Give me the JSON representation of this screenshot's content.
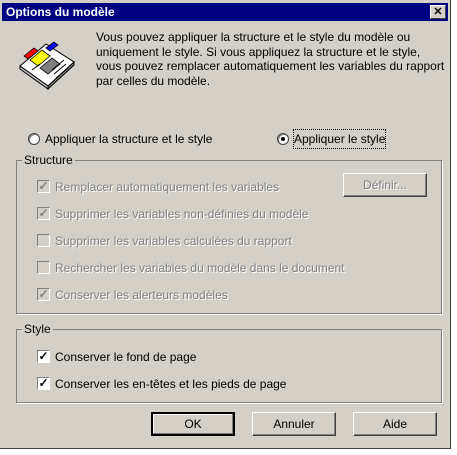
{
  "dialog": {
    "title": "Options du modèle",
    "close_label": "✕",
    "description": "Vous pouvez appliquer la structure et le style du modèle ou uniquement le style. Si vous appliquez la structure et le style, vous pouvez remplacer automatiquement les variables du rapport par celles du modèle."
  },
  "mode": {
    "options": [
      {
        "label": "Appliquer la structure et le style",
        "checked": false
      },
      {
        "label": "Appliquer le style",
        "checked": true
      }
    ]
  },
  "structure": {
    "title": "Structure",
    "items": [
      {
        "label": "Remplacer automatiquement les variables",
        "checked": true,
        "enabled": false
      },
      {
        "label": "Supprimer les variables non-définies du modèle",
        "checked": true,
        "enabled": false
      },
      {
        "label": "Supprimer les variables calculées du rapport",
        "checked": false,
        "enabled": false
      },
      {
        "label": "Rechercher les variables du modèle dans le document",
        "checked": false,
        "enabled": false
      },
      {
        "label": "Conserver les alerteurs modèles",
        "checked": true,
        "enabled": false
      }
    ],
    "define_button": "Définir..."
  },
  "style": {
    "title": "Style",
    "items": [
      {
        "label": "Conserver le fond de page",
        "checked": true
      },
      {
        "label": "Conserver les en-têtes et les pieds de page",
        "checked": true
      }
    ]
  },
  "buttons": {
    "ok": "OK",
    "cancel": "Annuler",
    "help": "Aide"
  }
}
